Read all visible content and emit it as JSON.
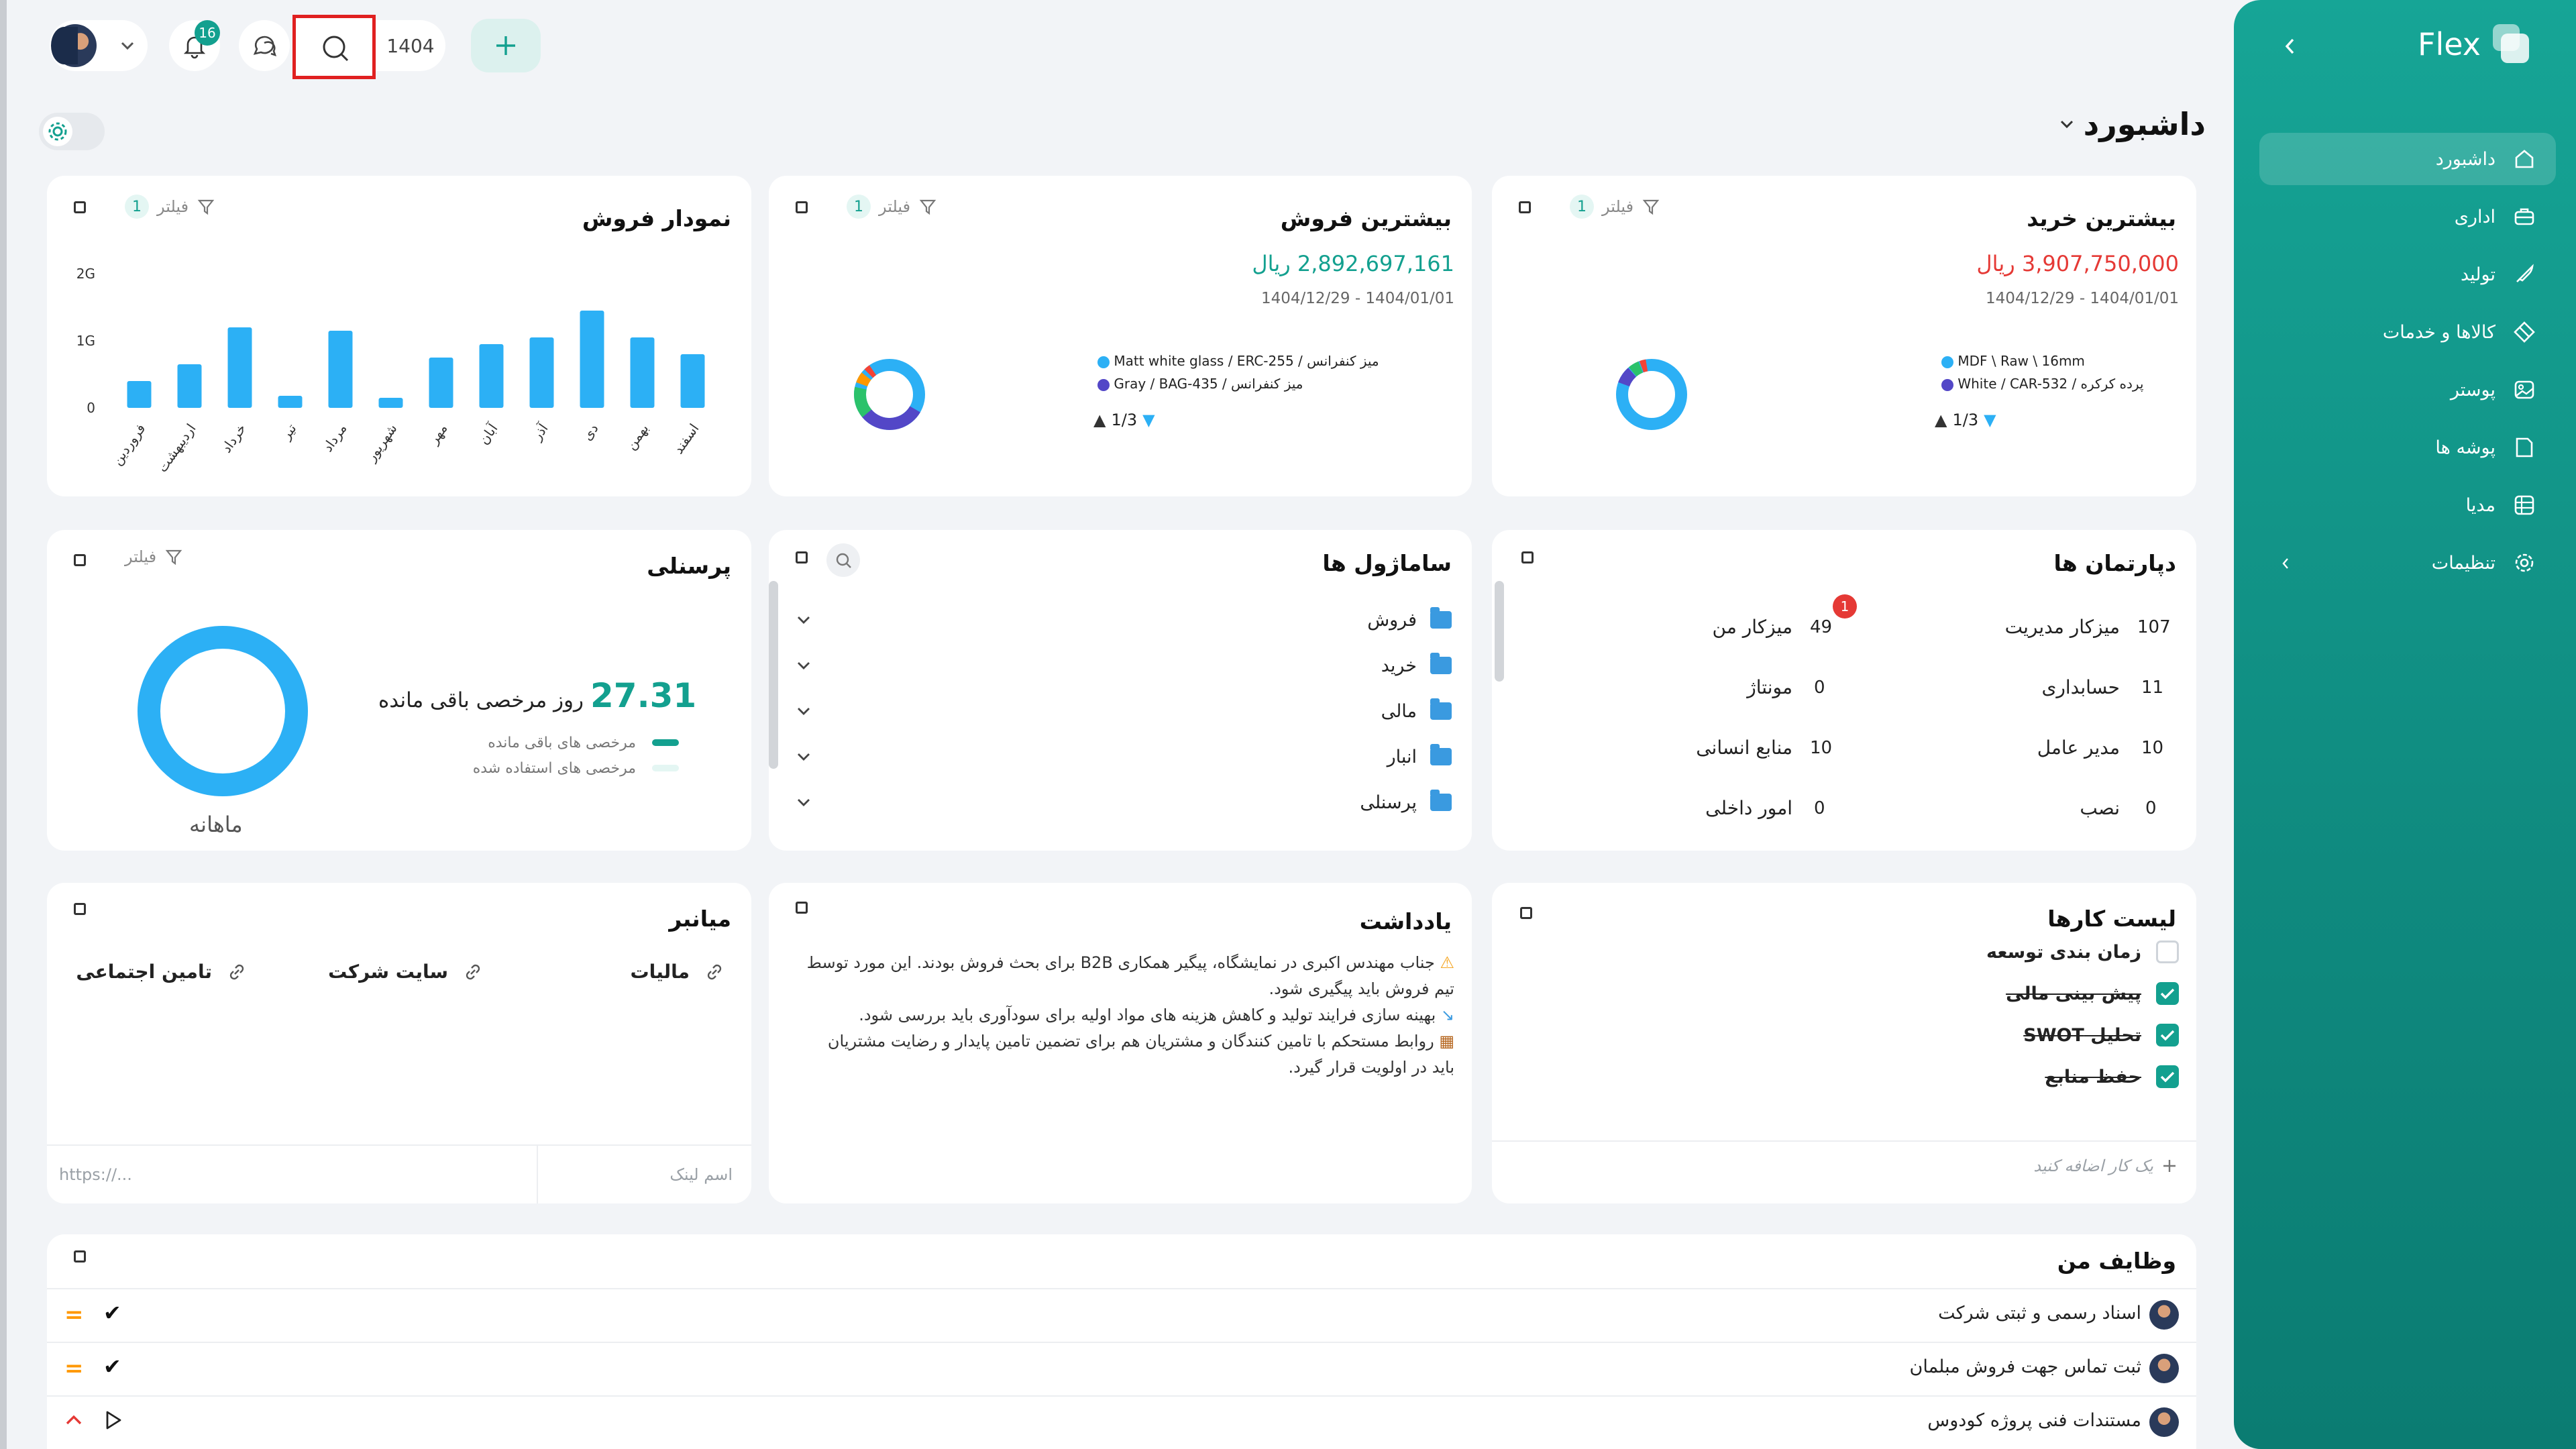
{
  "topbar": {
    "notifications_count": "16",
    "year": "1404"
  },
  "sidebar": {
    "logo": "Flex",
    "items": [
      {
        "label": "داشبورد",
        "icon": "home-icon"
      },
      {
        "label": "اداری",
        "icon": "briefcase-icon"
      },
      {
        "label": "تولید",
        "icon": "rocket-icon"
      },
      {
        "label": "کالاها و خدمات",
        "icon": "box-icon"
      },
      {
        "label": "پوستر",
        "icon": "image-icon"
      },
      {
        "label": "پوشه ها",
        "icon": "folder-icon"
      },
      {
        "label": "مدیا",
        "icon": "media-icon"
      },
      {
        "label": "تنظیمات",
        "icon": "gear-icon"
      }
    ]
  },
  "page": {
    "title": "داشبورد"
  },
  "filter_label": "فیلتر",
  "filter_count": "1",
  "top_purchase": {
    "title": "بیشترین خرید",
    "amount": "3,907,750,000 ریال",
    "range": "1404/12/29 - 1404/01/01",
    "legend": [
      "MDF \\ Raw \\ 16mm",
      "پرده کرکره / White / CAR-532"
    ],
    "pager": "1/3"
  },
  "top_sales": {
    "title": "بیشترین فروش",
    "amount": "2,892,697,161 ریال",
    "range": "1404/12/29 - 1404/01/01",
    "legend": [
      "میز کنفرانس / Matt white glass / ERC-255",
      "میز کنفرانس / Gray / BAG-435"
    ],
    "pager": "1/3"
  },
  "sales_chart": {
    "title": "نمودار فروش"
  },
  "chart_data": {
    "type": "bar",
    "categories": [
      "فروردین",
      "اردیبهشت",
      "خرداد",
      "تیر",
      "مرداد",
      "شهریور",
      "مهر",
      "آبان",
      "آذر",
      "دی",
      "بهمن",
      "اسفند"
    ],
    "values": [
      0.4,
      0.65,
      1.2,
      0.18,
      1.15,
      0.15,
      0.75,
      0.95,
      1.05,
      1.45,
      1.05,
      0.8
    ],
    "y_ticks": [
      "2G",
      "1G",
      "0"
    ],
    "ylim": [
      0,
      2
    ],
    "color": "#2cb0f5"
  },
  "departments": {
    "title": "دپارتمان ها",
    "rows": [
      {
        "right_num": "107",
        "right_label": "میزکار مدیریت",
        "left_num": "49",
        "left_label": "میزکار من",
        "left_badge": "1"
      },
      {
        "right_num": "11",
        "right_label": "حسابداری",
        "left_num": "0",
        "left_label": "مونتاژ"
      },
      {
        "right_num": "10",
        "right_label": "مدیر عامل",
        "left_num": "10",
        "left_label": "منابع انسانی"
      },
      {
        "right_num": "0",
        "right_label": "نصب",
        "left_num": "0",
        "left_label": "امور داخلی"
      }
    ]
  },
  "org_chart": {
    "title": "ساماژول ها",
    "items": [
      "فروش",
      "خرید",
      "مالی",
      "انبار",
      "پرسنلی"
    ]
  },
  "personnel": {
    "title": "پرسنلی",
    "value": "27.31",
    "value_label": "روز مرخصی باقی مانده",
    "legend_remaining": "مرخصی های باقی مانده",
    "legend_used": "مرخصی های استفاده شده",
    "period": "ماهانه"
  },
  "tasks": {
    "title": "لیست کارها",
    "items": [
      {
        "label": "زمان بندی توسعه",
        "done": false
      },
      {
        "label": "پیش بینی مالی",
        "done": true
      },
      {
        "label": "تحلیل SWOT",
        "done": true
      },
      {
        "label": "حفظ منابع",
        "done": true
      }
    ],
    "add_placeholder": "یک کار اضافه کنید"
  },
  "notes": {
    "title": "یادداشت",
    "lines": [
      "جناب مهندس اکبری در نمایشگاه، پیگیر همکاری B2B برای بحث فروش بودند. این مورد توسط",
      "تیم فروش باید پیگیری شود.",
      "بهینه سازی فرایند تولید و کاهش هزینه های مواد اولیه برای سودآوری باید بررسی شود.",
      "روابط مستحکم با تامین کنندگان و مشتریان هم برای تضمین  تامین پایدار و رضایت مشتریان",
      "باید در اولویت قرار گیرد."
    ]
  },
  "shortcuts": {
    "title": "میانبر",
    "links": [
      "مالیات",
      "سایت شرکت",
      "تامین اجتماعی"
    ],
    "name_placeholder": "اسم لینک",
    "url_placeholder": "https://..."
  },
  "my_tasks": {
    "title": "وظایف من",
    "items": [
      {
        "label": "اسناد رسمی و ثبتی شرکت",
        "status": "check",
        "priority": "="
      },
      {
        "label": "ثبت تماس جهت فروش مبلمان",
        "status": "check",
        "priority": "="
      },
      {
        "label": "مستندات فنی پروژه کودوس",
        "status": "play",
        "priority": "^"
      }
    ]
  }
}
